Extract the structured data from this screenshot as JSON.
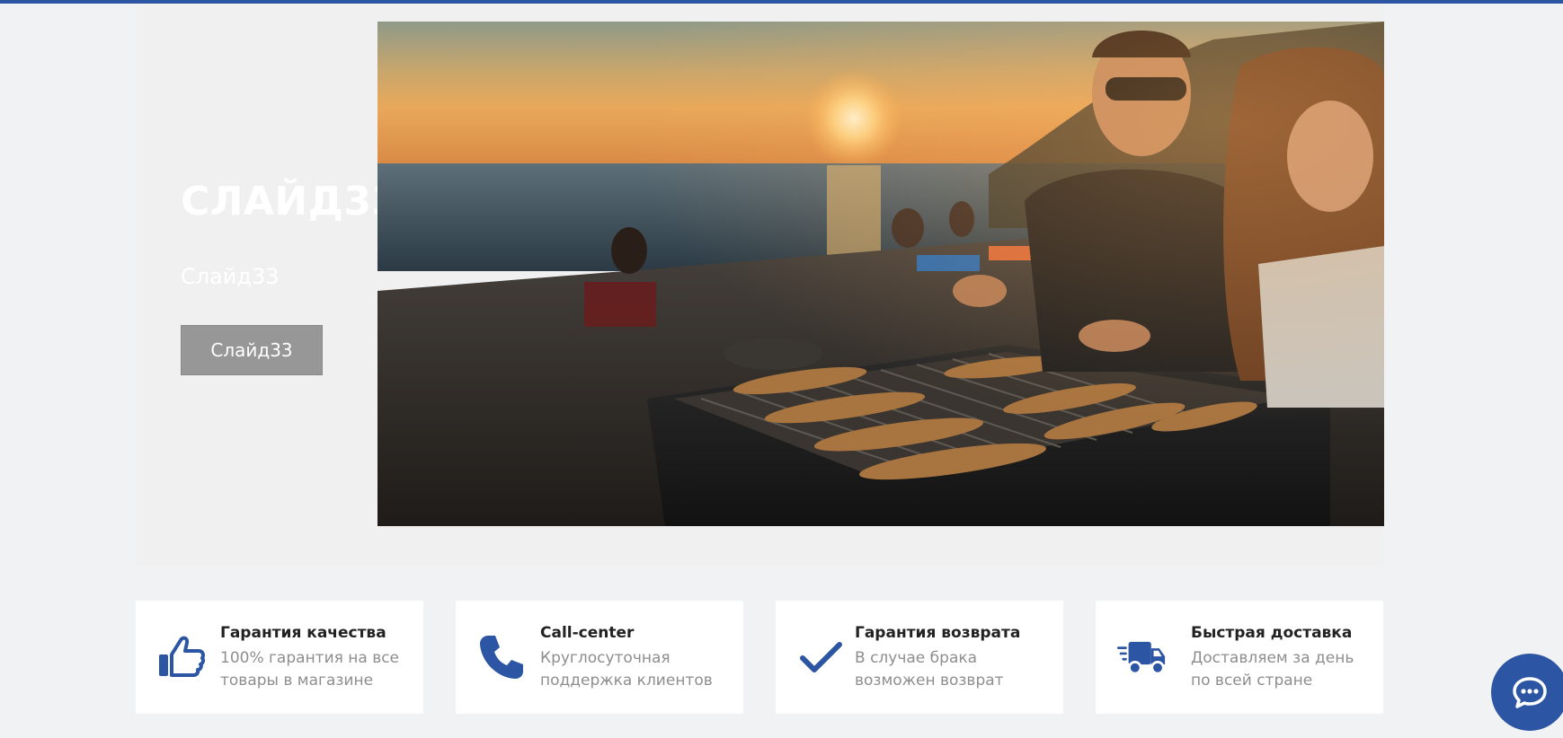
{
  "hero": {
    "title": "СЛАЙД33",
    "subtitle": "Слайд33",
    "button_label": "Слайд33"
  },
  "features": [
    {
      "icon": "thumbs-up-icon",
      "title": "Гарантия качества",
      "line1": "100% гарантия на все",
      "line2": "товары в магазине"
    },
    {
      "icon": "phone-icon",
      "title": "Call-center",
      "line1": "Круглосуточная",
      "line2": "поддержка клиентов"
    },
    {
      "icon": "checkmark-icon",
      "title": "Гарантия возврата",
      "line1": "В случае брака",
      "line2": "возможен возврат"
    },
    {
      "icon": "delivery-truck-icon",
      "title": "Быстрая доставка",
      "line1": "Доставляем за день",
      "line2": "по всей стране"
    }
  ],
  "colors": {
    "accent": "#2c55a3",
    "button_gray": "#979797",
    "background": "#f1f2f4"
  },
  "chat": {
    "icon": "chat-bubble-icon"
  }
}
